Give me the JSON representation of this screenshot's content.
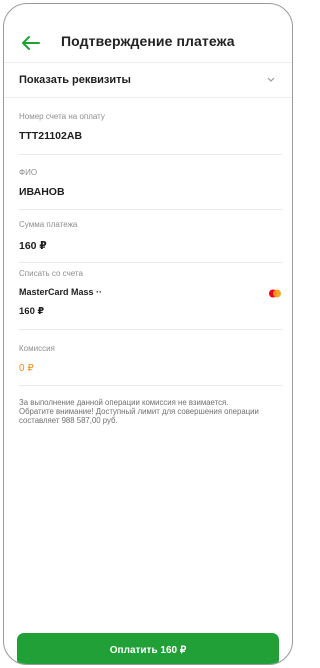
{
  "header": {
    "title": "Подтверждение платежа"
  },
  "details": {
    "label": "Показать реквизиты"
  },
  "fields": [
    {
      "label": "Номер счета на оплату",
      "value": "TTT21102AB"
    },
    {
      "label": "ФИО",
      "value": "ИВАНОВ"
    },
    {
      "label": "Сумма платежа",
      "value": "160 ₽"
    }
  ],
  "debit": {
    "label": "Списать со счета",
    "card_name": "MasterCard Mass ··",
    "amount": "160 ₽",
    "card_icon": "mastercard-icon"
  },
  "commission": {
    "label": "Комиссия",
    "value": "0 ₽"
  },
  "note": {
    "line1": "За выполнение данной операции комиссия не взимается.",
    "line2": "Обратите внимание! Доступный лимит для совершения операции составляет 988 587,00 руб."
  },
  "pay_button": {
    "label": "Оплатить 160 ₽"
  },
  "colors": {
    "accent": "#21a038",
    "commission": "#f08c1a"
  }
}
